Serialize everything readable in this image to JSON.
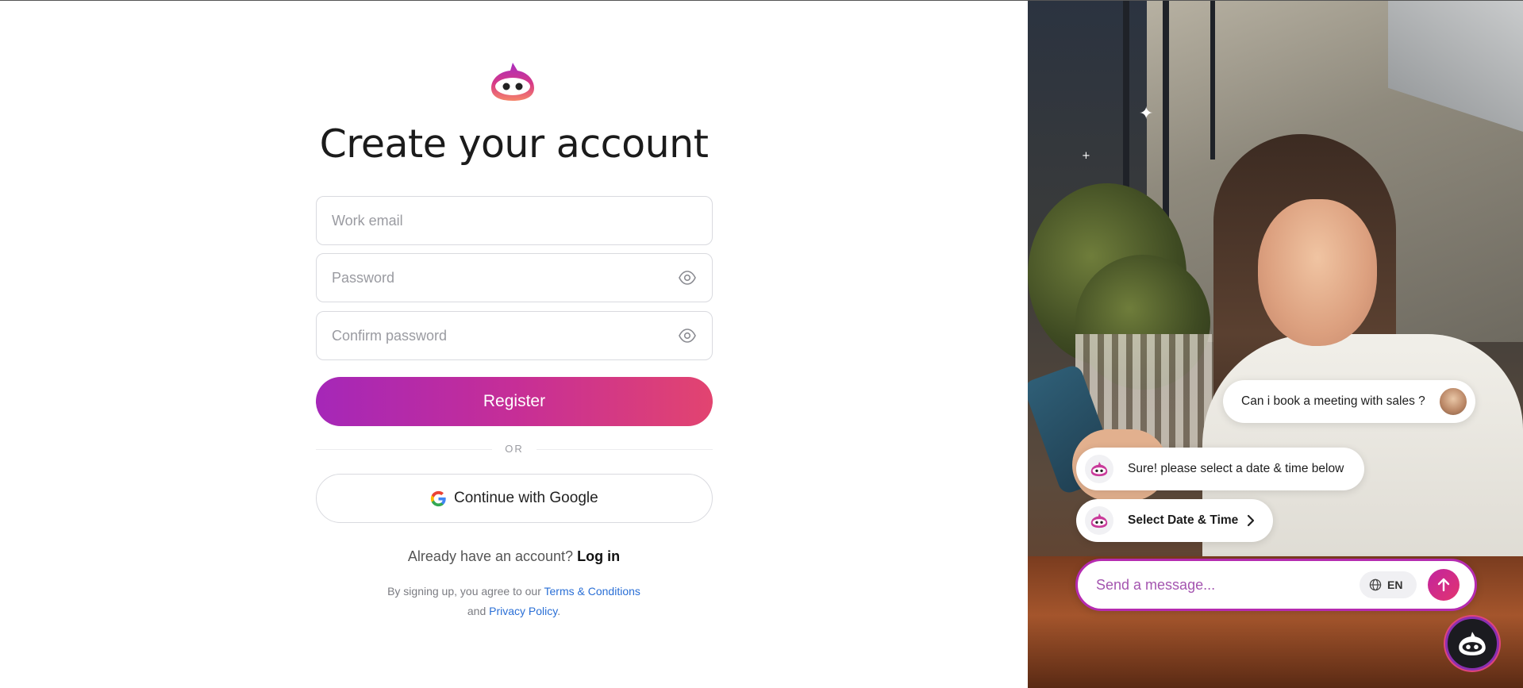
{
  "page": {
    "title": "Create your account"
  },
  "form": {
    "email_placeholder": "Work email",
    "password_placeholder": "Password",
    "confirm_placeholder": "Confirm password",
    "register_label": "Register",
    "or_label": "OR",
    "google_label": "Continue with Google"
  },
  "footer": {
    "have_account": "Already have an account?",
    "login_label": "Log in",
    "legal_prefix": "By signing up, you agree to our",
    "terms_label": "Terms & Conditions",
    "legal_and": "and",
    "privacy_label": "Privacy Policy",
    "legal_period": "."
  },
  "chat": {
    "user_message": "Can i book a meeting with sales ?",
    "bot_message": "Sure! please select a date & time below",
    "bot_action": "Select Date & Time",
    "input_placeholder": "Send a message...",
    "language": "EN"
  },
  "colors": {
    "brand_gradient_start": "#a527b8",
    "brand_gradient_end": "#e24470",
    "link": "#2a6fd6"
  }
}
